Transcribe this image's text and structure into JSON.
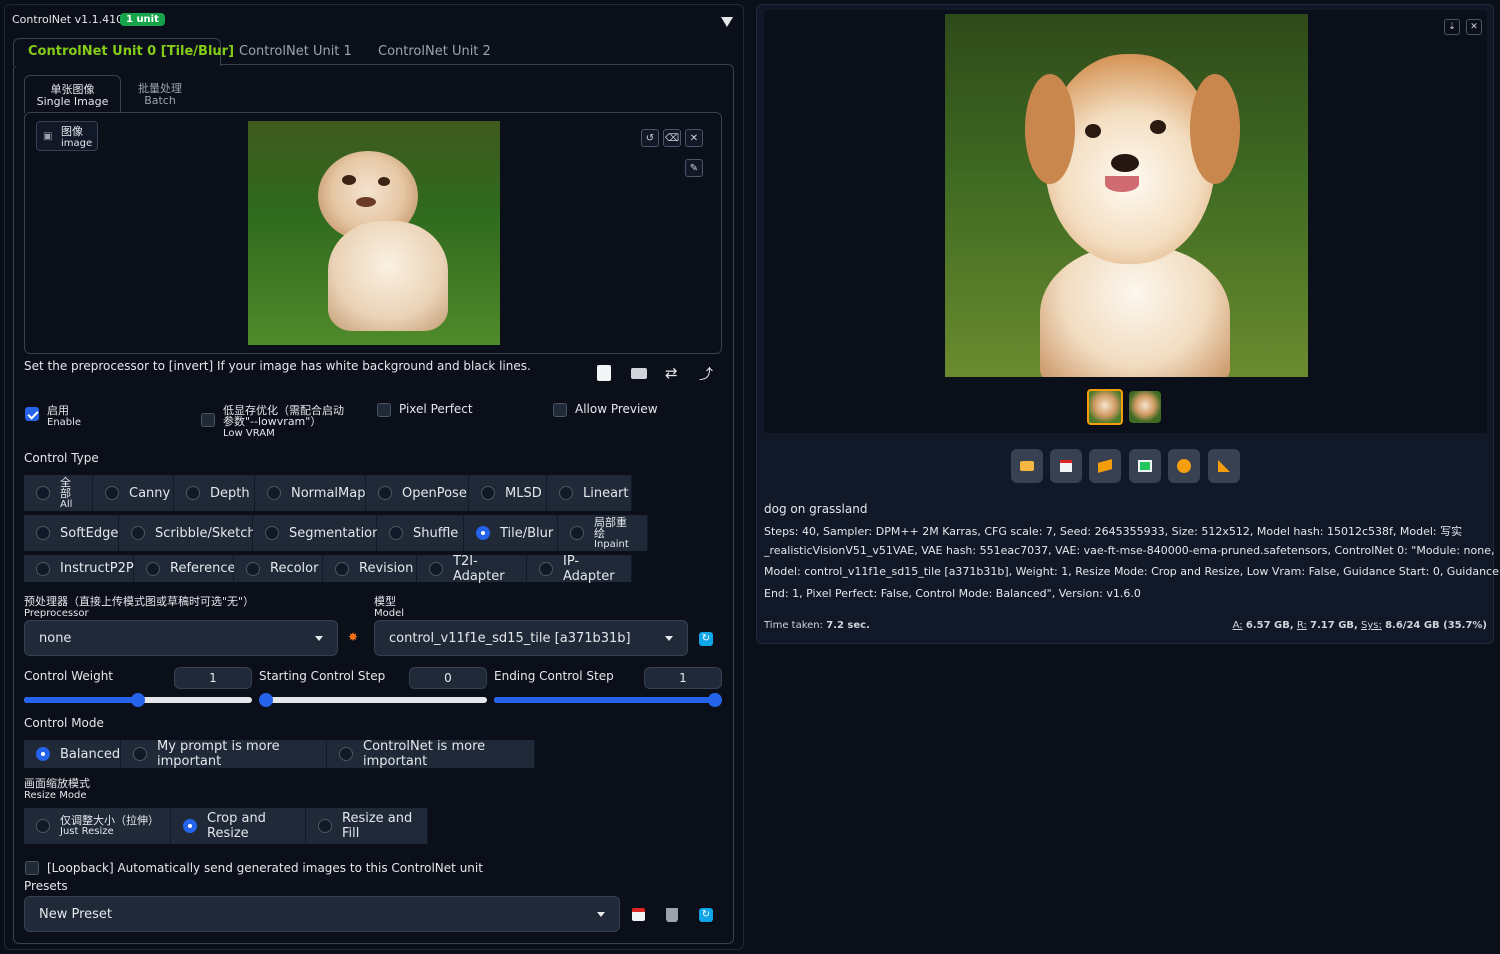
{
  "header": {
    "title": "ControlNet v1.1.410",
    "badge": "1 unit"
  },
  "tabs": [
    "ControlNet Unit 0 [Tile/Blur]",
    "ControlNet Unit 1",
    "ControlNet Unit 2"
  ],
  "subtabs": [
    {
      "cn": "单张图像",
      "en": "Single Image"
    },
    {
      "cn": "批量处理",
      "en": "Batch"
    }
  ],
  "image_label": {
    "cn": "图像",
    "en": "image"
  },
  "hint": "Set the preprocessor to [invert] If your image has white background and black lines.",
  "options": {
    "enable": {
      "cn": "启用",
      "en": "Enable",
      "checked": true
    },
    "low_vram": {
      "cn1": "低显存优化（需配合启动",
      "cn2": "参数\"--lowvram\"）",
      "en": "Low VRAM",
      "checked": false
    },
    "pixel_perfect": {
      "label": "Pixel Perfect",
      "checked": false
    },
    "allow_preview": {
      "label": "Allow Preview",
      "checked": false
    }
  },
  "control_type": {
    "label": "Control Type",
    "all": {
      "cn": "全部",
      "en": "All"
    },
    "row1": [
      "Canny",
      "Depth",
      "NormalMap",
      "OpenPose",
      "MLSD",
      "Lineart"
    ],
    "row2": [
      "SoftEdge",
      "Scribble/Sketch",
      "Segmentation",
      "Shuffle",
      "Tile/Blur"
    ],
    "inpaint": {
      "cn": "局部重绘",
      "en": "Inpaint"
    },
    "row3": [
      "InstructP2P",
      "Reference",
      "Recolor",
      "Revision",
      "T2I-Adapter",
      "IP-Adapter"
    ],
    "selected": "Tile/Blur"
  },
  "preprocessor": {
    "cn": "预处理器（直接上传模式图或草稿时可选\"无\"）",
    "en": "Preprocessor",
    "value": "none"
  },
  "model": {
    "cn": "模型",
    "en": "Model",
    "value": "control_v11f1e_sd15_tile [a371b31b]"
  },
  "sliders": [
    {
      "label": "Control Weight",
      "value": "1",
      "fraction": 0.5
    },
    {
      "label": "Starting Control Step",
      "value": "0",
      "fraction": 0.0
    },
    {
      "label": "Ending Control Step",
      "value": "1",
      "fraction": 1.0
    }
  ],
  "control_mode": {
    "label": "Control Mode",
    "options": [
      "Balanced",
      "My prompt is more important",
      "ControlNet is more important"
    ],
    "selected": "Balanced"
  },
  "resize_mode": {
    "cn": "画面缩放模式",
    "en": "Resize Mode",
    "just_resize": {
      "cn": "仅调整大小（拉伸）",
      "en": "Just Resize"
    },
    "options": [
      "Crop and Resize",
      "Resize and Fill"
    ],
    "selected": "Crop and Resize"
  },
  "loopback": "[Loopback] Automatically send generated images to this ControlNet unit",
  "presets": {
    "label": "Presets",
    "value": "New Preset"
  },
  "output": {
    "prompt": "dog on grassland",
    "info_line1": "Steps: 40, Sampler: DPM++ 2M Karras, CFG scale: 7, Seed: 2645355933, Size: 512x512, Model hash: 15012c538f, Model: 写实",
    "info_line2": "_realisticVisionV51_v51VAE, VAE hash: 551eac7037, VAE: vae-ft-mse-840000-ema-pruned.safetensors, ControlNet 0: \"Module: none,",
    "info_line3": "Model: control_v11f1e_sd15_tile [a371b31b], Weight: 1, Resize Mode: Crop and Resize, Low Vram: False, Guidance Start: 0, Guidance",
    "info_line4": "End: 1, Pixel Perfect: False, Control Mode: Balanced\", Version: v1.6.0",
    "time_label": "Time taken:",
    "time_value": "7.2 sec.",
    "mem_a_label": "A:",
    "mem_a": "6.57 GB,",
    "mem_r_label": "R:",
    "mem_r": "7.17 GB,",
    "mem_sys_label": "Sys:",
    "mem_sys": "8.6/24 GB (35.7%)"
  },
  "tool_icons": [
    "folder-icon",
    "save-icon",
    "zip-icon",
    "send-to-img2img-icon",
    "send-to-inpaint-icon",
    "extras-icon"
  ]
}
